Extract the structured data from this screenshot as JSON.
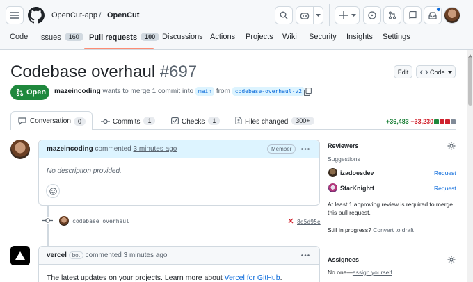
{
  "header": {
    "owner": "OpenCut-app",
    "separator": "/",
    "repo": "OpenCut"
  },
  "repo_tabs": [
    {
      "label": "Code",
      "count": null
    },
    {
      "label": "Issues",
      "count": "160"
    },
    {
      "label": "Pull requests",
      "count": "100"
    },
    {
      "label": "Discussions",
      "count": null
    },
    {
      "label": "Actions",
      "count": null
    },
    {
      "label": "Projects",
      "count": null
    },
    {
      "label": "Wiki",
      "count": null
    },
    {
      "label": "Security",
      "count": null
    },
    {
      "label": "Insights",
      "count": null
    },
    {
      "label": "Settings",
      "count": null
    }
  ],
  "pr": {
    "title": "Codebase overhaul",
    "number": "#697",
    "edit_label": "Edit",
    "code_label": "Code",
    "state_label": "Open",
    "author": "mazeincoding",
    "merge_text": "wants to merge 1 commit into",
    "base_branch": "main",
    "from_text": "from",
    "head_branch": "codebase-overhaul-v2"
  },
  "pr_tabs": [
    {
      "label": "Conversation",
      "count": "0"
    },
    {
      "label": "Commits",
      "count": "1"
    },
    {
      "label": "Checks",
      "count": "1"
    },
    {
      "label": "Files changed",
      "count": "300+"
    }
  ],
  "diffstat": {
    "additions": "+36,483",
    "deletions": "−33,230"
  },
  "comment1": {
    "author": "mazeincoding",
    "action": "commented",
    "time": "3 minutes ago",
    "role_badge": "Member",
    "body": "No description provided."
  },
  "commit_event": {
    "message": "codebase overhaul",
    "sha": "8d5d95e"
  },
  "comment2": {
    "author": "vercel",
    "bot_badge": "bot",
    "action": "commented",
    "time": "3 minutes ago",
    "body_prefix": "The latest updates on your projects. Learn more about",
    "body_link": "Vercel for GitHub",
    "body_suffix": "."
  },
  "sidebar": {
    "reviewers_title": "Reviewers",
    "suggestions_label": "Suggestions",
    "suggested": [
      {
        "name": "izadoesdev",
        "action": "Request"
      },
      {
        "name": "StarKnightt",
        "action": "Request"
      }
    ],
    "approval_note": "At least 1 approving review is required to merge this pull request.",
    "in_progress_text": "Still in progress?",
    "convert_draft_link": "Convert to draft",
    "assignees_title": "Assignees",
    "no_one_text": "No one—",
    "assign_yourself_link": "assign yourself"
  },
  "colors": {
    "accent_underline": "#fd8c73",
    "open_green": "#1f883d",
    "addition_green": "#1a7f37",
    "deletion_red": "#d1242f",
    "link_blue": "#0969da"
  },
  "icons": [
    "hamburger-icon",
    "github-logo-icon",
    "search-icon",
    "copilot-icon",
    "plus-icon",
    "issues-icon",
    "pull-request-icon",
    "repo-icon",
    "inbox-icon",
    "pr-open-icon",
    "copy-icon",
    "conversation-icon",
    "commit-icon",
    "checks-icon",
    "file-diff-icon",
    "kebab-icon",
    "smiley-icon",
    "gear-icon",
    "x-icon",
    "triangle-logo-icon"
  ]
}
